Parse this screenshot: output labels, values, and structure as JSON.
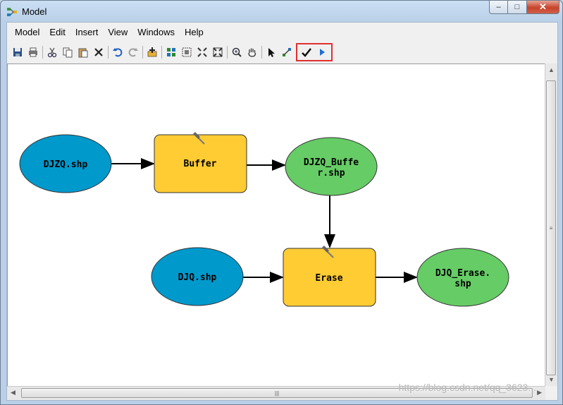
{
  "window": {
    "title": "Model",
    "min_glyph": "–",
    "max_glyph": "□",
    "close_glyph": "✕"
  },
  "menu": [
    "Model",
    "Edit",
    "Insert",
    "View",
    "Windows",
    "Help"
  ],
  "toolbar": {
    "icons": [
      "save-icon",
      "print-icon",
      "cut-icon",
      "copy-icon",
      "paste-icon",
      "delete-icon",
      "undo-icon",
      "redo-icon",
      "add-data-icon",
      "auto-layout-icon",
      "full-extent-icon",
      "zoom-in-fixed-icon",
      "zoom-out-fixed-icon",
      "zoom-icon",
      "pan-icon",
      "select-icon",
      "connect-icon",
      "validate-icon",
      "run-icon"
    ]
  },
  "nodes": {
    "djzq": {
      "label": "DJZQ.shp",
      "color": "#0099cc"
    },
    "buffer": {
      "label": "Buffer",
      "color": "#ffcc33"
    },
    "djzq_buffer": {
      "line1": "DJZQ_Buffe",
      "line2": "r.shp",
      "color": "#66cc66"
    },
    "djq": {
      "label": "DJQ.shp",
      "color": "#0099cc"
    },
    "erase": {
      "label": "Erase",
      "color": "#ffcc33"
    },
    "djq_erase": {
      "line1": "DJQ_Erase.",
      "line2": "shp",
      "color": "#66cc66"
    }
  },
  "watermark": "https://blog.csdn.net/qq_3623..."
}
